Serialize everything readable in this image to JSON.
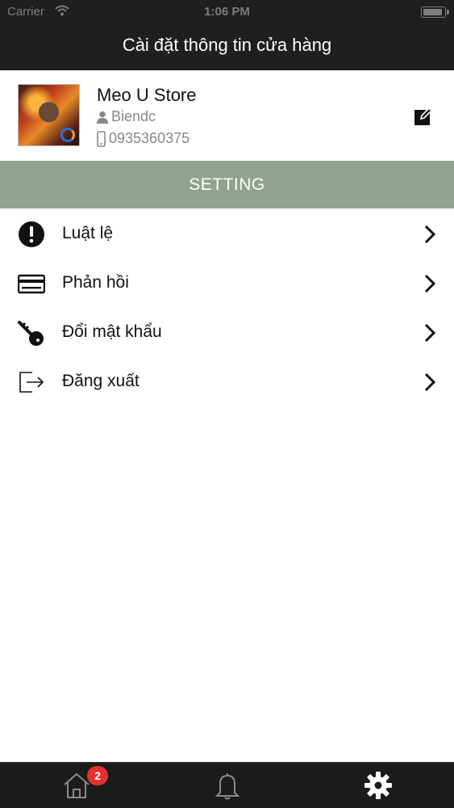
{
  "status_bar": {
    "carrier": "Carrier",
    "time": "1:06 PM",
    "battery_level": 0.95
  },
  "header": {
    "title": "Cài đặt thông tin cửa hàng"
  },
  "profile": {
    "store_name": "Meo U Store",
    "owner": "Biendc",
    "phone": "0935360375",
    "avatar_icon": "store-avatar-image",
    "edit_icon": "edit-icon"
  },
  "section": {
    "title": "SETTING",
    "color": "#91a292"
  },
  "menu": [
    {
      "label": "Luật lệ",
      "icon": "exclamation-circle-icon"
    },
    {
      "label": "Phản hồi",
      "icon": "credit-card-icon"
    },
    {
      "label": "Đổi mật khẩu",
      "icon": "key-icon"
    },
    {
      "label": "Đăng xuất",
      "icon": "logout-icon"
    }
  ],
  "tabbar": {
    "home_badge": "2",
    "tabs": [
      "home-icon",
      "bell-icon",
      "gear-icon"
    ],
    "badge_color": "#e5302f"
  }
}
